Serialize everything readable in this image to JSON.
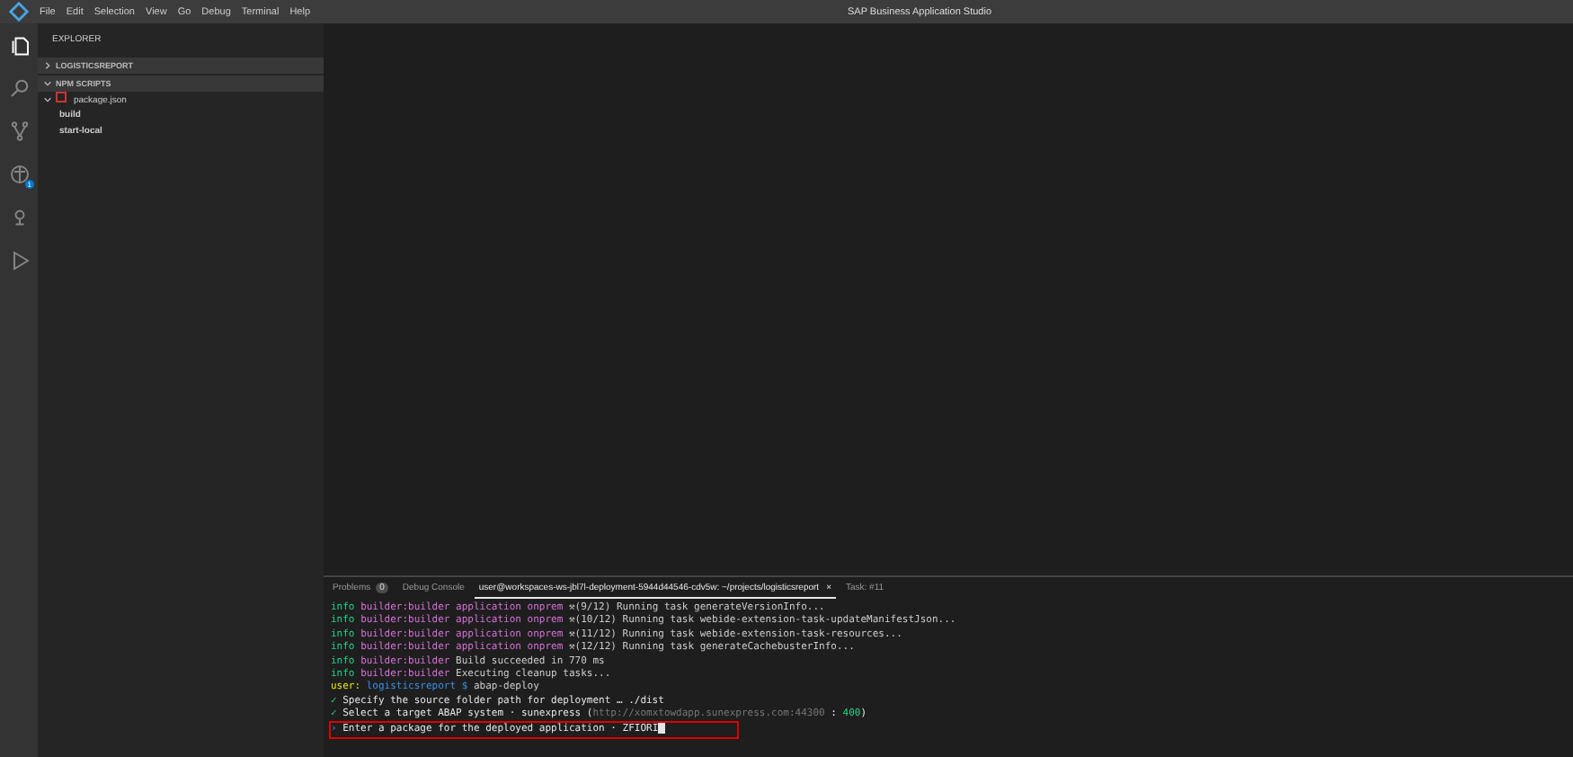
{
  "menu": [
    "File",
    "Edit",
    "Selection",
    "View",
    "Go",
    "Debug",
    "Terminal",
    "Help"
  ],
  "window": {
    "title": "SAP Business Application Studio"
  },
  "activity_bar": [
    {
      "selected": true
    },
    {
      "selected": false
    },
    {
      "selected": false
    },
    {
      "selected": false,
      "badge": "1"
    },
    {
      "selected": false
    },
    {
      "selected": false
    }
  ],
  "explorer": {
    "title": "EXPLORER",
    "sections": [
      {
        "label": "LOGISTICSREPORT",
        "expanded": false
      },
      {
        "label": "NPM SCRIPTS",
        "expanded": true
      }
    ],
    "tree": [
      {
        "label": "package.json",
        "expanded": true,
        "children": [
          {
            "label": "build"
          },
          {
            "label": "start-local"
          }
        ]
      }
    ]
  },
  "panel": {
    "tabs": [
      {
        "label": "Problems",
        "badge": "0",
        "selected": false,
        "closable": false
      },
      {
        "label": "Debug Console",
        "selected": false,
        "closable": false
      },
      {
        "label": "user@workspaces-ws-jbl7l-deployment-5944d44546-cdv5w: ~/projects/logisticsreport",
        "selected": true,
        "closable": true,
        "close": "×"
      },
      {
        "label": "Task: #11",
        "selected": false,
        "closable": false
      }
    ],
    "lines": [
      {
        "highlighted": false,
        "segments": [
          {
            "text": "info ",
            "kind": "level"
          },
          {
            "text": "builder:builder application onprem ",
            "kind": "source"
          },
          {
            "text": "⚒(9/12) Running task generateVersionInfo...",
            "kind": "text"
          }
        ]
      },
      {
        "highlighted": false,
        "segments": [
          {
            "text": "info ",
            "kind": "level"
          },
          {
            "text": "builder:builder application onprem ",
            "kind": "source"
          },
          {
            "text": "⚒(10/12) Running task webide-extension-task-updateManifestJson...",
            "kind": "text"
          }
        ]
      },
      {
        "highlighted": false,
        "segments": [
          {
            "text": "info ",
            "kind": "level"
          },
          {
            "text": "builder:builder application onprem ",
            "kind": "source"
          },
          {
            "text": "⚒(11/12) Running task webide-extension-task-resources...",
            "kind": "text"
          }
        ]
      },
      {
        "highlighted": false,
        "segments": [
          {
            "text": "info ",
            "kind": "level"
          },
          {
            "text": "builder:builder application onprem ",
            "kind": "source"
          },
          {
            "text": "⚒(12/12) Running task generateCachebusterInfo...",
            "kind": "text"
          }
        ]
      },
      {
        "highlighted": false,
        "segments": [
          {
            "text": "info ",
            "kind": "level"
          },
          {
            "text": "builder:builder ",
            "kind": "source"
          },
          {
            "text": "Build succeeded in 770 ms",
            "kind": "text"
          }
        ]
      },
      {
        "highlighted": false,
        "segments": [
          {
            "text": "info ",
            "kind": "level"
          },
          {
            "text": "builder:builder ",
            "kind": "source"
          },
          {
            "text": "Executing cleanup tasks...",
            "kind": "text"
          }
        ]
      },
      {
        "highlighted": false,
        "segments": [
          {
            "text": "user: ",
            "kind": "user"
          },
          {
            "text": "logisticsreport $ ",
            "kind": "path"
          },
          {
            "text": "abap-deploy",
            "kind": "text"
          }
        ]
      },
      {
        "highlighted": false,
        "segments": [
          {
            "text": "✓ ",
            "kind": "done"
          },
          {
            "text": "Specify the source folder path for deployment … ./dist",
            "kind": "answer"
          }
        ]
      },
      {
        "highlighted": false,
        "segments": [
          {
            "text": "✓ ",
            "kind": "done"
          },
          {
            "text": "Select a target ABAP system · sunexpress (",
            "kind": "answer"
          },
          {
            "text": "http://xomxtowdapp.sunexpress.com:44300",
            "kind": "url"
          },
          {
            "text": " : ",
            "kind": "answer"
          },
          {
            "text": "400",
            "kind": "level"
          },
          {
            "text": ")",
            "kind": "answer"
          }
        ]
      },
      {
        "highlighted": true,
        "segments": [
          {
            "text": "› ",
            "kind": "prompt"
          },
          {
            "text": "Enter a package for the deployed application · ",
            "kind": "answer"
          },
          {
            "text": "ZFIORI",
            "kind": "answer"
          }
        ]
      }
    ]
  }
}
